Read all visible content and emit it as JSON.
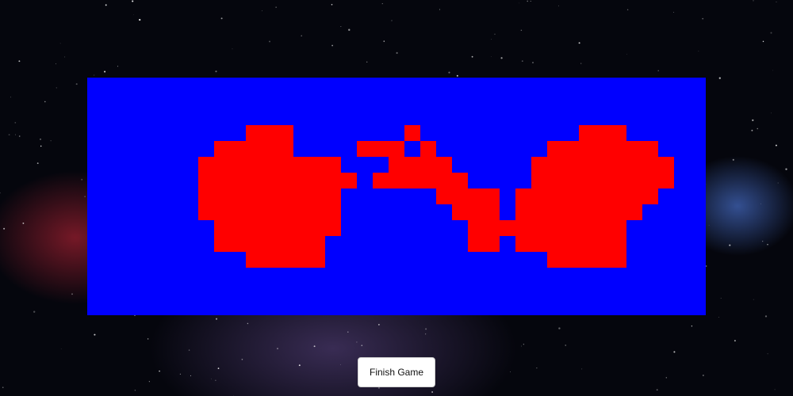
{
  "game": {
    "colors": {
      "board_background": "#0000ff",
      "pixel_fill": "#ff0000"
    },
    "grid": {
      "columns": 39,
      "rows": 15,
      "rows_data": [
        ".......................................",
        ".......................................",
        ".......................................",
        "..........###.......#..........###.....",
        "........#####....###.#.......#######...",
        ".......#########...####.....#########...",
        ".......##########.######....#########...",
        ".......#########......####.#########....",
        ".......#########.......###.########.....",
        "........########........##########......",
        "........#######.........##.#######......",
        "..........#####..............#####......",
        ".......................................",
        ".......................................",
        "......................................."
      ]
    }
  },
  "controls": {
    "finish_button_label": "Finish Game"
  }
}
